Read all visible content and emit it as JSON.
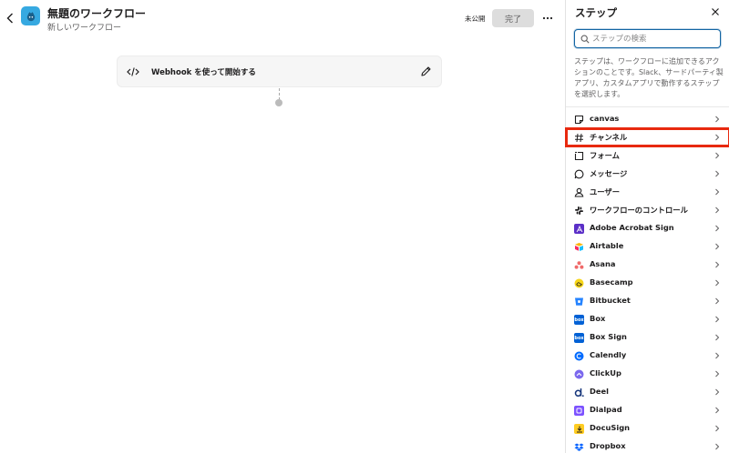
{
  "header": {
    "title": "無題のワークフロー",
    "subtitle": "新しいワークフロー",
    "status": "未公開",
    "done_label": "完了"
  },
  "canvas": {
    "trigger_step_label": "Webhook を使って開始する"
  },
  "panel": {
    "title": "ステップ",
    "search_placeholder": "ステップの検索",
    "description": "ステップは、ワークフローに追加できるアクションのことです。Slack、サードパーティ製アプリ、カスタムアプリで動作するステップを選択します。",
    "items": [
      {
        "label": "canvas",
        "icon": "canvas-icon"
      },
      {
        "label": "チャンネル",
        "icon": "hash-icon"
      },
      {
        "label": "フォーム",
        "icon": "form-icon"
      },
      {
        "label": "メッセージ",
        "icon": "message-icon"
      },
      {
        "label": "ユーザー",
        "icon": "user-icon"
      },
      {
        "label": "ワークフローのコントロール",
        "icon": "slack-icon"
      },
      {
        "label": "Adobe Acrobat Sign",
        "icon": "adobe-sign-icon"
      },
      {
        "label": "Airtable",
        "icon": "airtable-icon"
      },
      {
        "label": "Asana",
        "icon": "asana-icon"
      },
      {
        "label": "Basecamp",
        "icon": "basecamp-icon"
      },
      {
        "label": "Bitbucket",
        "icon": "bitbucket-icon"
      },
      {
        "label": "Box",
        "icon": "box-icon"
      },
      {
        "label": "Box Sign",
        "icon": "box-sign-icon"
      },
      {
        "label": "Calendly",
        "icon": "calendly-icon"
      },
      {
        "label": "ClickUp",
        "icon": "clickup-icon"
      },
      {
        "label": "Deel",
        "icon": "deel-icon"
      },
      {
        "label": "Dialpad",
        "icon": "dialpad-icon"
      },
      {
        "label": "DocuSign",
        "icon": "docusign-icon"
      },
      {
        "label": "Dropbox",
        "icon": "dropbox-icon"
      }
    ]
  },
  "colors": {
    "highlight": "#e8290f",
    "focus_blue": "#1264a3",
    "workflow_icon_bg": "#36a9e1"
  }
}
